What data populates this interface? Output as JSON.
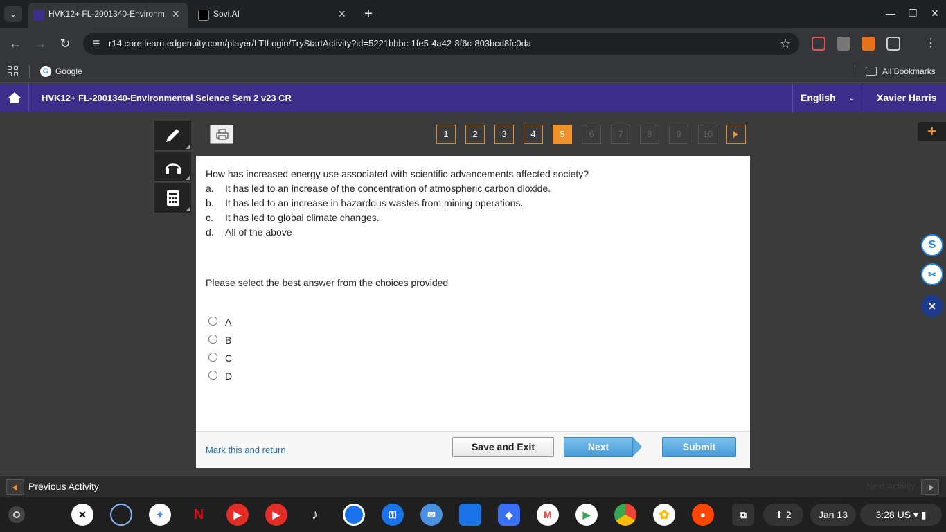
{
  "browser": {
    "tabs": [
      {
        "title": "HVK12+ FL-2001340-Environm",
        "close": "✕"
      },
      {
        "title": "Sovi.AI",
        "close": "✕"
      }
    ],
    "url": "r14.core.learn.edgenuity.com/player/LTILogin/TryStartActivity?id=5221bbbc-1fe5-4a42-8f6c-803bcd8fc0da",
    "bookmarks": {
      "google": "Google",
      "all": "All Bookmarks"
    }
  },
  "header": {
    "course": "HVK12+ FL-2001340-Environmental Science Sem 2 v23 CR",
    "language": "English",
    "user": "Xavier Harris"
  },
  "question_nav": {
    "numbers": [
      "1",
      "2",
      "3",
      "4",
      "5",
      "6",
      "7",
      "8",
      "9",
      "10"
    ],
    "current": "5"
  },
  "question": {
    "text": "How has increased energy use associated with scientific advancements affected society?",
    "choices": [
      {
        "letter": "a.",
        "text": "It has led to an increase of the concentration of atmospheric carbon dioxide."
      },
      {
        "letter": "b.",
        "text": "It has led to an increase in hazardous wastes from mining operations."
      },
      {
        "letter": "c.",
        "text": "It has led to global climate changes."
      },
      {
        "letter": "d.",
        "text": "All of the above"
      }
    ],
    "instruction": "Please select the best answer from the choices provided",
    "options": [
      "A",
      "B",
      "C",
      "D"
    ]
  },
  "footer": {
    "mark_return": "Mark this and return",
    "save_exit": "Save and Exit",
    "next": "Next",
    "submit": "Submit"
  },
  "activity_bar": {
    "previous": "Previous Activity",
    "next": "Next Activity"
  },
  "side_tools": {
    "s": "S",
    "scissors": "✂",
    "x": "✕"
  },
  "shelf": {
    "notifications": "2",
    "date": "Jan 13",
    "time": "3:28",
    "locale": "US"
  }
}
